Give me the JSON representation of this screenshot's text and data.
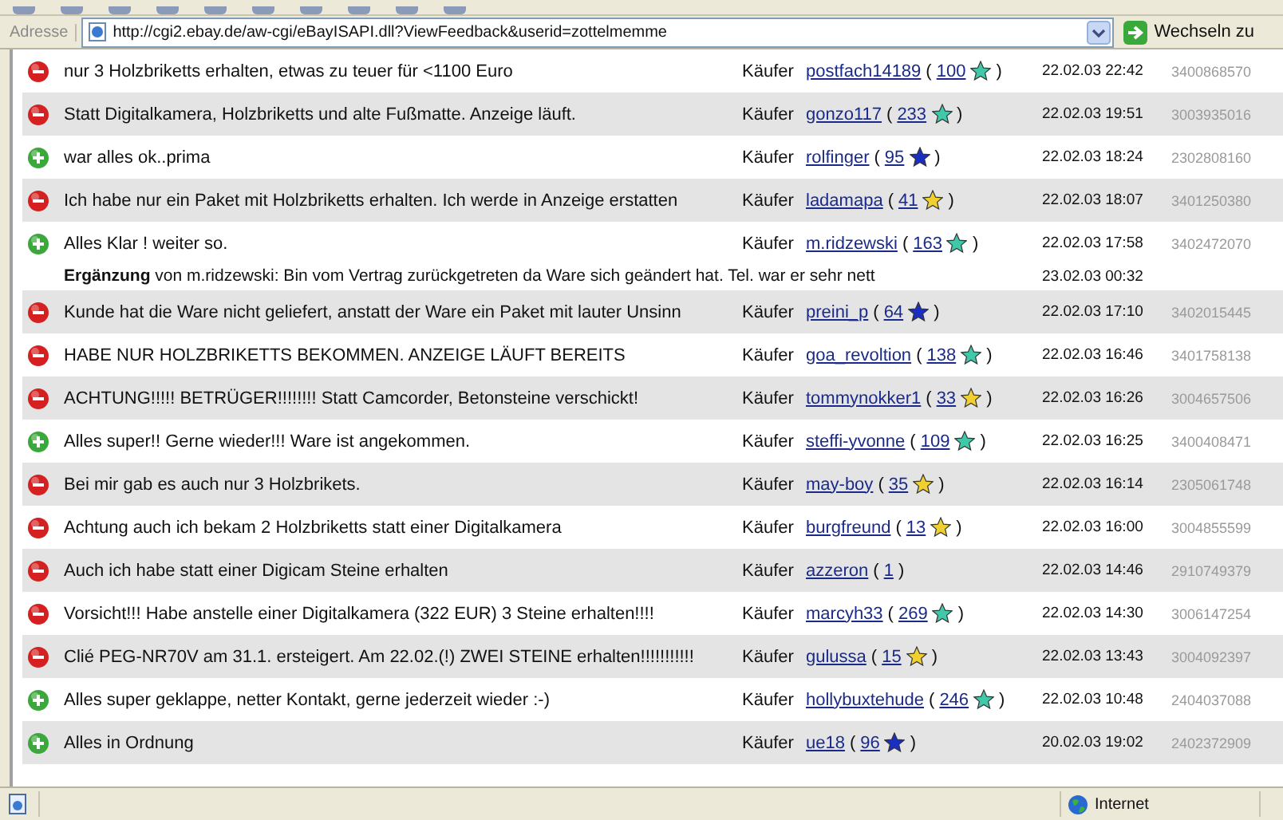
{
  "address_bar": {
    "label": "Adresse",
    "url": "http://cgi2.ebay.de/aw-cgi/eBayISAPI.dll?ViewFeedback&userid=zottelmemme",
    "go_button": "Wechseln zu"
  },
  "feedback": [
    {
      "kind": "negative",
      "comment": "nur 3 Holzbriketts erhalten, etwas zu teuer für <1100 Euro",
      "role": "Käufer",
      "user": "postfach14189",
      "open": "(",
      "score": "100",
      "color": "#40c8a8",
      "close": ")",
      "date": "22.02.03 22:42",
      "item": "3400868570"
    },
    {
      "kind": "negative",
      "comment": "Statt Digitalkamera, Holzbriketts und alte Fußmatte. Anzeige läuft.",
      "role": "Käufer",
      "user": "gonzo117",
      "open": "(",
      "score": "233",
      "color": "#40c8a8",
      "close": ")",
      "date": "22.02.03 19:51",
      "item": "3003935016"
    },
    {
      "kind": "positive",
      "comment": "war alles ok..prima",
      "role": "Käufer",
      "user": "rolfinger",
      "open": "(",
      "score": "95",
      "color": "#1a2ec0",
      "close": ")",
      "date": "22.02.03 18:24",
      "item": "2302808160"
    },
    {
      "kind": "negative",
      "comment": "Ich habe nur ein Paket mit Holzbriketts erhalten. Ich werde in Anzeige erstatten",
      "role": "Käufer",
      "user": "ladamapa",
      "open": "(",
      "score": "41",
      "color": "#f0d030",
      "close": ")",
      "date": "22.02.03 18:07",
      "item": "3401250380"
    },
    {
      "kind": "positive",
      "comment": "Alles Klar ! weiter so.",
      "role": "Käufer",
      "user": "m.ridzewski",
      "open": "(",
      "score": "163",
      "color": "#40c8a8",
      "close": ")",
      "date": "22.02.03 17:58",
      "item": "3402472070",
      "reply": {
        "text": "**Ergänzung** von m.ridzewski: Bin vom Vertrag zurückgetreten da Ware sich geändert hat. Tel. war er sehr nett",
        "date": "23.02.03 00:32"
      }
    },
    {
      "kind": "negative",
      "comment": "Kunde hat die Ware nicht geliefert, anstatt der Ware ein Paket mit lauter Unsinn",
      "role": "Käufer",
      "user": "preini_p",
      "open": "(",
      "score": "64",
      "color": "#1a2ec0",
      "close": ")",
      "date": "22.02.03 17:10",
      "item": "3402015445"
    },
    {
      "kind": "negative",
      "comment": "HABE NUR HOLZBRIKETTS BEKOMMEN. ANZEIGE LÄUFT BEREITS",
      "role": "Käufer",
      "user": "goa_revoltion",
      "open": "(",
      "score": "138",
      "color": "#40c8a8",
      "close": ")",
      "date": "22.02.03 16:46",
      "item": "3401758138"
    },
    {
      "kind": "negative",
      "comment": "ACHTUNG!!!!! BETRÜGER!!!!!!!! Statt Camcorder, Betonsteine verschickt!",
      "role": "Käufer",
      "user": "tommynokker1",
      "open": "(",
      "score": "33",
      "color": "#f0d030",
      "close": ")",
      "date": "22.02.03 16:26",
      "item": "3004657506"
    },
    {
      "kind": "positive",
      "comment": "Alles super!! Gerne wieder!!! Ware ist angekommen.",
      "role": "Käufer",
      "user": "steffi-yvonne",
      "open": "(",
      "score": "109",
      "color": "#40c8a8",
      "close": ")",
      "date": "22.02.03 16:25",
      "item": "3400408471"
    },
    {
      "kind": "negative",
      "comment": "Bei mir gab es auch nur 3 Holzbrikets.",
      "role": "Käufer",
      "user": "may-boy",
      "open": "(",
      "score": "35",
      "color": "#f0d030",
      "close": ")",
      "date": "22.02.03 16:14",
      "item": "2305061748"
    },
    {
      "kind": "negative",
      "comment": "Achtung auch ich bekam 2 Holzbriketts statt einer Digitalkamera",
      "role": "Käufer",
      "user": "burgfreund",
      "open": "(",
      "score": "13",
      "color": "#f0d030",
      "close": ")",
      "date": "22.02.03 16:00",
      "item": "3004855599"
    },
    {
      "kind": "negative",
      "comment": "Auch ich habe statt einer Digicam Steine erhalten",
      "role": "Käufer",
      "user": "azzeron",
      "open": "(",
      "score": "1",
      "close": ")",
      "date": "22.02.03 14:46",
      "item": "2910749379"
    },
    {
      "kind": "negative",
      "comment": "Vorsicht!!! Habe anstelle einer Digitalkamera (322 EUR) 3 Steine erhalten!!!!",
      "role": "Käufer",
      "user": "marcyh33",
      "open": "(",
      "score": "269",
      "color": "#40c8a8",
      "close": ")",
      "date": "22.02.03 14:30",
      "item": "3006147254"
    },
    {
      "kind": "negative",
      "comment": "Clié PEG-NR70V am 31.1. ersteigert. Am 22.02.(!) ZWEI STEINE erhalten!!!!!!!!!!!",
      "role": "Käufer",
      "user": "gulussa",
      "open": "(",
      "score": "15",
      "color": "#f0d030",
      "close": ")",
      "date": "22.02.03 13:43",
      "item": "3004092397"
    },
    {
      "kind": "positive",
      "comment": "Alles super geklappe, netter Kontakt, gerne jederzeit wieder :-)",
      "role": "Käufer",
      "user": "hollybuxtehude",
      "open": "(",
      "score": "246",
      "color": "#40c8a8",
      "close": ")",
      "date": "22.02.03 10:48",
      "item": "2404037088"
    },
    {
      "kind": "positive",
      "comment": "Alles in Ordnung",
      "role": "Käufer",
      "user": "ue18",
      "open": "(",
      "score": "96",
      "color": "#1a2ec0",
      "close": ")",
      "date": "20.02.03 19:02",
      "item": "2402372909"
    }
  ],
  "status_bar": {
    "zone": "Internet"
  }
}
